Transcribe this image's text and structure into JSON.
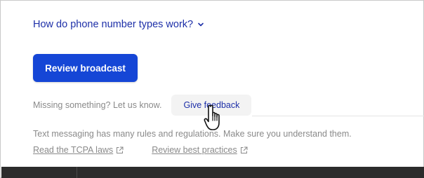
{
  "faq": {
    "label": "How do phone number types work?",
    "icon": "chevron-down-icon"
  },
  "actions": {
    "review_label": "Review broadcast"
  },
  "feedback": {
    "prompt": "Missing something? Let us know.",
    "button_label": "Give feedback"
  },
  "compliance": {
    "text": "Text messaging has many rules and regulations. Make sure you understand them.",
    "links": [
      {
        "label": "Read the TCPA laws",
        "icon": "external-link-icon"
      },
      {
        "label": "Review best practices",
        "icon": "external-link-icon"
      }
    ]
  },
  "colors": {
    "primary": "#1546d6",
    "link": "#1d2fa8",
    "muted": "#8a8a8a",
    "bottom_bar": "#2c2c2c"
  }
}
